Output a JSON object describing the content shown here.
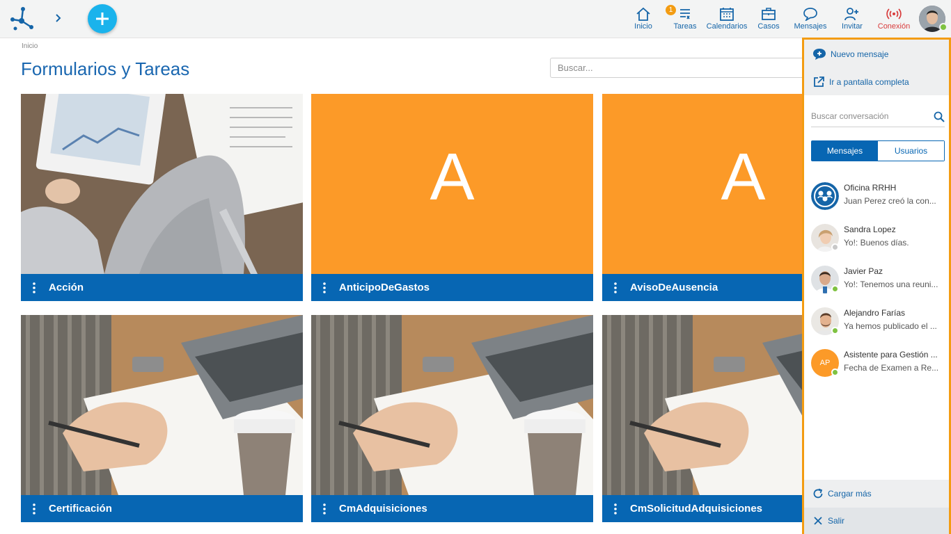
{
  "topbar": {
    "nav": [
      {
        "id": "inicio",
        "label": "Inicio",
        "icon": "home-icon"
      },
      {
        "id": "tareas",
        "label": "Tareas",
        "icon": "tasks-icon",
        "badge": "1"
      },
      {
        "id": "calendarios",
        "label": "Calendarios",
        "icon": "calendar-icon"
      },
      {
        "id": "casos",
        "label": "Casos",
        "icon": "briefcase-icon"
      },
      {
        "id": "mensajes",
        "label": "Mensajes",
        "icon": "chat-bubble-icon"
      },
      {
        "id": "invitar",
        "label": "Invitar",
        "icon": "add-user-icon"
      },
      {
        "id": "conexion",
        "label": "Conexión",
        "icon": "connection-icon"
      }
    ],
    "accent": "#1565a8",
    "add_button_color": "#1ab3ec"
  },
  "main": {
    "breadcrumb": "Inicio",
    "title": "Formularios y Tareas",
    "search_placeholder": "Buscar...",
    "cards": [
      {
        "name": "Acción",
        "media": "photo-tablet"
      },
      {
        "name": "AnticipoDeGastos",
        "media": "letter",
        "letter": "A"
      },
      {
        "name": "AvisoDeAusencia",
        "media": "letter",
        "letter": "A"
      },
      {
        "name": "Certificación",
        "media": "photo-writing"
      },
      {
        "name": "CmAdquisiciones",
        "media": "photo-writing"
      },
      {
        "name": "CmSolicitudAdquisiciones",
        "media": "photo-writing"
      }
    ],
    "card_bar_color": "#0766b3",
    "letter_bg_color": "#fc9a28"
  },
  "chat": {
    "new_message": "Nuevo mensaje",
    "full_screen": "Ir a pantalla completa",
    "search_placeholder": "Buscar conversación",
    "tabs": [
      "Mensajes",
      "Usuarios"
    ],
    "conversations": [
      {
        "name": "Oficina RRHH",
        "message": "Juan Perez creó la con...",
        "status": "none"
      },
      {
        "name": "Sandra Lopez",
        "message": "Yo!: Buenos días.",
        "status": "offline"
      },
      {
        "name": "Javier Paz",
        "message": "Yo!: Tenemos una reuni...",
        "status": "online"
      },
      {
        "name": "Alejandro Farías",
        "message": "Ya hemos publicado el ...",
        "status": "online"
      },
      {
        "name": "Asistente para Gestión ...",
        "message": "Fecha de Examen a Re...",
        "status": "online",
        "initials": "AP"
      }
    ],
    "load_more": "Cargar más",
    "exit": "Salir",
    "border_color": "#f39c12"
  }
}
